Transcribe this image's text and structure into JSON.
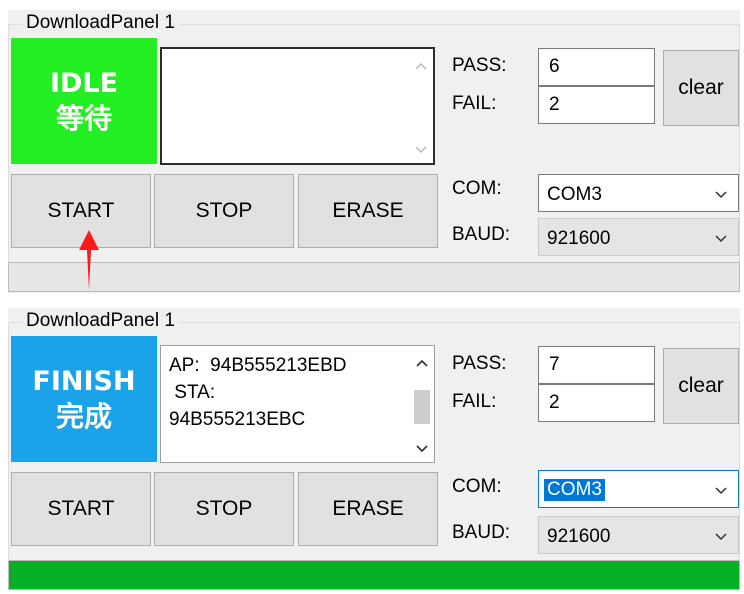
{
  "panels": [
    {
      "title": "DownloadPanel 1",
      "status": {
        "en": "IDLE",
        "zh": "等待",
        "color": "#22ee22"
      },
      "log": [],
      "pass_label": "PASS:",
      "fail_label": "FAIL:",
      "pass_value": "6",
      "fail_value": "2",
      "clear_label": "clear",
      "start_label": "START",
      "stop_label": "STOP",
      "erase_label": "ERASE",
      "com_label": "COM:",
      "baud_label": "BAUD:",
      "com_value": "COM3",
      "baud_value": "921600",
      "progress": 0
    },
    {
      "title": "DownloadPanel 1",
      "status": {
        "en": "FINISH",
        "zh": "完成",
        "color": "#1aa3e8"
      },
      "log": [
        "AP:  94B555213EBD",
        " STA:",
        "94B555213EBC"
      ],
      "pass_label": "PASS:",
      "fail_label": "FAIL:",
      "pass_value": "7",
      "fail_value": "2",
      "clear_label": "clear",
      "start_label": "START",
      "stop_label": "STOP",
      "erase_label": "ERASE",
      "com_label": "COM:",
      "baud_label": "BAUD:",
      "com_value": "COM3",
      "baud_value": "921600",
      "progress": 1.0
    }
  ],
  "icons": {
    "scroll_up": "chevron-up-icon",
    "scroll_down": "chevron-down-icon",
    "dropdown": "chevron-down-icon",
    "annotation": "red-arrow-icon"
  },
  "colors": {
    "progress_fill": "#06b025",
    "annotation_arrow": "#ff1a1a",
    "selection": "#0078d7"
  }
}
